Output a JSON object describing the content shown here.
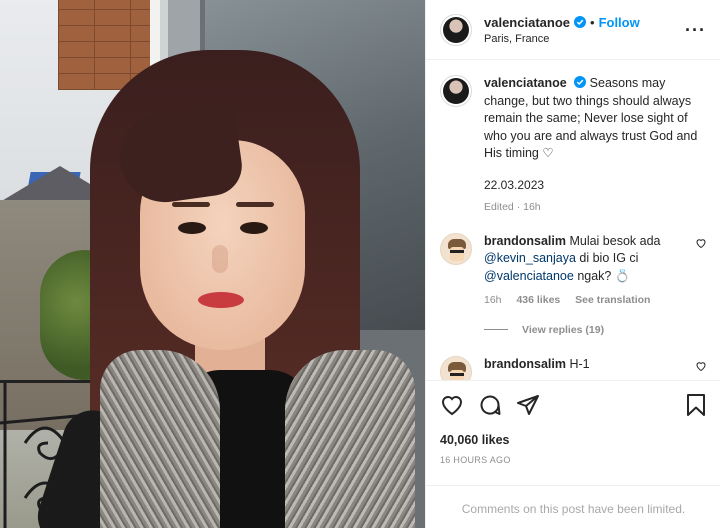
{
  "header": {
    "username": "valenciatanoe",
    "separator": "•",
    "follow_label": "Follow",
    "location": "Paris, France",
    "more_label": "···"
  },
  "caption": {
    "username": "valenciatanoe",
    "text": "Seasons may change, but two things should always remain the same; Never lose sight of who you are and always trust God and His timing",
    "heart": "♡",
    "date": "22.03.2023",
    "edited": "Edited · 16h"
  },
  "comments": [
    {
      "username": "brandonsalim",
      "text_before": "Mulai besok ada",
      "mention_1": "@kevin_sanjaya",
      "text_middle": "di bio IG ci",
      "mention_2": "@valenciatanoe",
      "text_after": "ngak?",
      "emoji": "💍",
      "time": "16h",
      "likes": "436 likes",
      "see_translation": "See translation",
      "view_replies": "View replies (19)"
    },
    {
      "username": "brandonsalim",
      "text": "H-1"
    }
  ],
  "actions": {
    "likes": "40,060 likes",
    "time_ago": "16 HOURS AGO"
  },
  "footer": {
    "limited": "Comments on this post have been limited."
  },
  "colors": {
    "accent": "#0095f6",
    "verified": "#0095f6",
    "mention": "#00376b",
    "muted": "#8e8e8e",
    "border": "#efefef"
  },
  "icons": [
    "verified-badge-icon",
    "more-options-icon",
    "heart-icon",
    "comment-icon",
    "share-icon",
    "save-icon",
    "ring-emoji"
  ]
}
